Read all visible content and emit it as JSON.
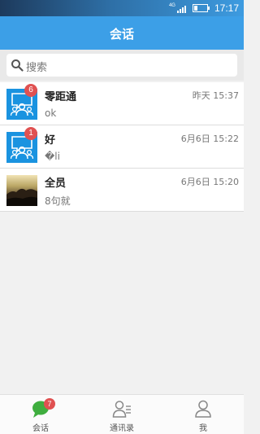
{
  "status_bar": {
    "network": "4G",
    "time": "17:17"
  },
  "header": {
    "title": "会话"
  },
  "search": {
    "placeholder": "搜索"
  },
  "conversations": [
    {
      "name": "零距通",
      "last_message": "ok",
      "time": "昨天 15:37",
      "unread": "6",
      "avatar": "group-avatar"
    },
    {
      "name": "好",
      "last_message": "�li",
      "time": "6月6日 15:22",
      "unread": "1",
      "avatar": "group-avatar"
    },
    {
      "name": "全员",
      "last_message": "8句就",
      "time": "6月6日 15:20",
      "unread": "",
      "avatar": "photo-avatar"
    }
  ],
  "tabs": [
    {
      "label": "会话",
      "badge": "7",
      "icon": "chat-bubble-icon"
    },
    {
      "label": "通讯录",
      "icon": "contacts-icon"
    },
    {
      "label": "我",
      "icon": "person-icon"
    }
  ],
  "colors": {
    "accent": "#3c9fe7",
    "badge": "#e05151",
    "active_tab": "#3fae3f"
  }
}
